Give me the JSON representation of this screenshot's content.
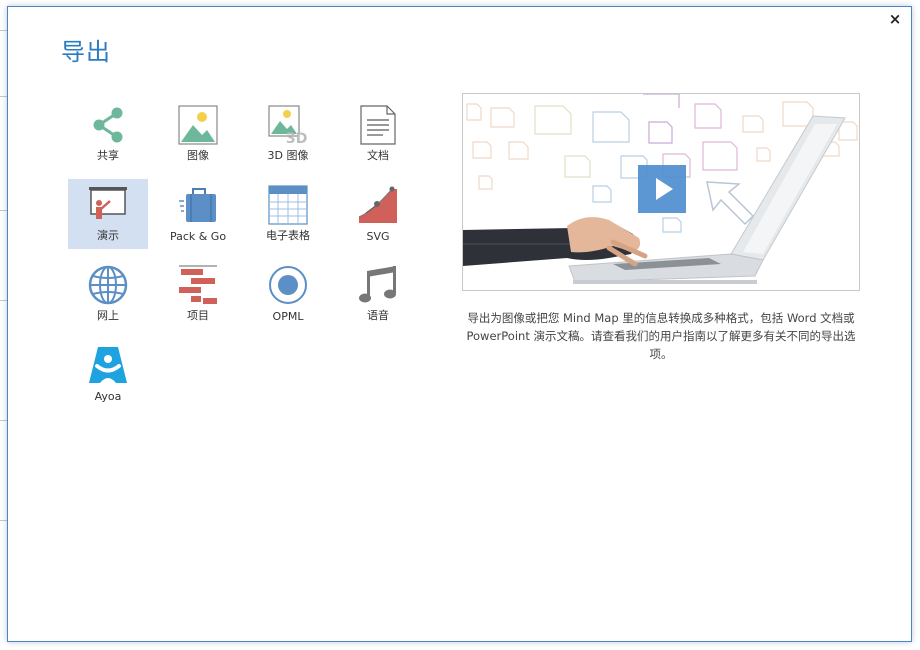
{
  "dialog": {
    "title": "导出",
    "close_label": "×"
  },
  "tiles": [
    {
      "label": "共享",
      "icon": "share-icon"
    },
    {
      "label": "图像",
      "icon": "image-icon"
    },
    {
      "label": "3D 图像",
      "icon": "3d-image-icon",
      "badge": "3D"
    },
    {
      "label": "文档",
      "icon": "document-icon"
    },
    {
      "label": "演示",
      "icon": "presentation-icon",
      "selected": true
    },
    {
      "label": "Pack & Go",
      "icon": "briefcase-icon"
    },
    {
      "label": "电子表格",
      "icon": "spreadsheet-icon"
    },
    {
      "label": "SVG",
      "icon": "svg-icon"
    },
    {
      "label": "网上",
      "icon": "globe-icon"
    },
    {
      "label": "项目",
      "icon": "project-gantt-icon"
    },
    {
      "label": "OPML",
      "icon": "opml-icon"
    },
    {
      "label": "语音",
      "icon": "music-note-icon"
    },
    {
      "label": "Ayoa",
      "icon": "ayoa-logo-icon"
    }
  ],
  "video": {
    "play_icon": "play-icon"
  },
  "description": "导出为图像或把您 Mind Map 里的信息转换成多种格式，包括 Word 文档或 PowerPoint 演示文稿。请查看我们的用户指南以了解更多有关不同的导出选项。",
  "colors": {
    "accent": "#2a7bbf",
    "selected_tile": "#d3e0f1",
    "icon_red": "#d0605a",
    "icon_blue": "#5b8fc6",
    "icon_green": "#6db89a",
    "play": "#4f8fd1"
  }
}
